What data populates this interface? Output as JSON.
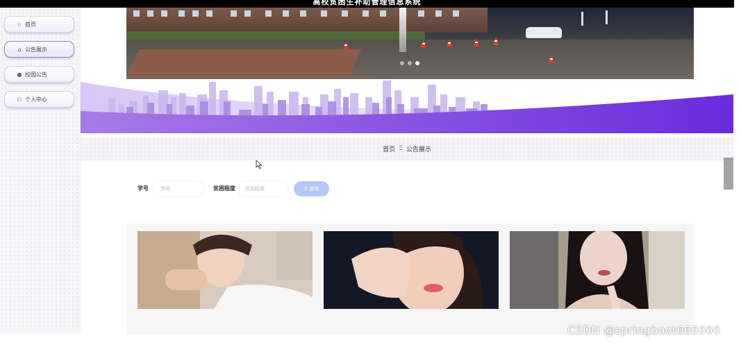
{
  "app": {
    "title": "高校贫困生补助管理信息系统"
  },
  "sidebar": {
    "items": [
      {
        "label": "首页",
        "icon": "star-icon"
      },
      {
        "label": "公告展示",
        "icon": "home-icon"
      },
      {
        "label": "校园公告",
        "icon": "info-icon"
      },
      {
        "label": "个人中心",
        "icon": "user-icon"
      }
    ],
    "active_index": 1
  },
  "carousel": {
    "slide_count": 3,
    "active_index": 2
  },
  "breadcrumb": {
    "home": "首页",
    "separator": "Ξ",
    "current": "公告展示"
  },
  "search": {
    "student_id_label": "学号",
    "student_id_placeholder": "学号",
    "poverty_label": "贫困程度",
    "poverty_placeholder": "贫困程度",
    "button_label": "查询"
  },
  "cards": [
    {
      "name": "announcement-card-1"
    },
    {
      "name": "announcement-card-2"
    },
    {
      "name": "announcement-card-3"
    }
  ],
  "watermark": "CSDN @springboot666666",
  "colors": {
    "accent_purple": "#7b3fe4",
    "search_button": "#b5c8f5",
    "topbar": "#000000"
  }
}
